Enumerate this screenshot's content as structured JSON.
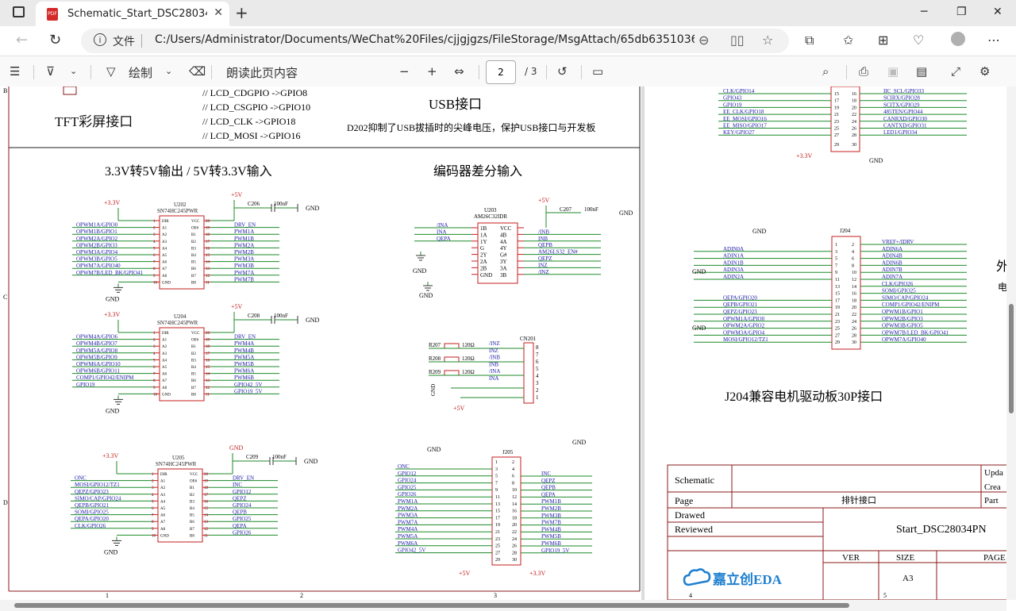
{
  "browser": {
    "tab_title": "Schematic_Start_DSC28034PNT_V",
    "pdf_badge": "PDF",
    "file_label": "文件",
    "url": "C:/Users/Administrator/Documents/WeChat%20Files/cjjgjgzs/FileStorage/MsgAttach/65db63510361e9532e..."
  },
  "pdf_toolbar": {
    "draw_label": "绘制",
    "read_aloud_label": "朗读此页内容",
    "page_current": "2",
    "page_total": "/ 3"
  },
  "schematic": {
    "top_left": {
      "tft_title": "TFT彩屏接口",
      "pin_notes": [
        "// LCD_CDGPIO ->GPIO8",
        "// LCD_CSGPIO ->GPIO10",
        "// LCD_CLK ->GPIO18",
        "// LCD_MOSI ->GPIO16"
      ],
      "usb_title": "USB接口",
      "usb_note": "D202抑制了USB拔插时的尖峰电压，保护USB接口与开发板"
    },
    "level_shift_title": "3.3V转5V输出 / 5V转3.3V输入",
    "encoder_title": "编码器差分输入",
    "u202": {
      "ref": "U202",
      "part": "SN74HC245PWR",
      "vcc": "+3.3V",
      "pwr": "+5V",
      "cap": "C206",
      "capval": "100nF",
      "gnd": "GND",
      "left_nets": [
        "OPWM1A/GPIO0",
        "OPWM1B/GPIO1",
        "OPWM2A/GPIO2",
        "OPWM2B/GPIO3",
        "OPWM3A/GPIO4",
        "OPWM3B/GPIO5",
        "OPWM7A/GPIO40",
        "OPWM7B/LED_BK/GPIO41"
      ],
      "right_nets": [
        "DRV_EN",
        "PWM1A",
        "PWM1B",
        "PWM2A",
        "PWM2B",
        "PWM3A",
        "PWM3B",
        "PWM7A",
        "PWM7B"
      ]
    },
    "u204": {
      "ref": "U204",
      "part": "SN74HC245PWR",
      "vcc": "+3.3V",
      "pwr": "+5V",
      "cap": "C208",
      "capval": "100nF",
      "gnd": "GND",
      "left_nets": [
        "OPWM4A/GPIO6",
        "OPWM4B/GPIO7",
        "OPWM5A/GPIO8",
        "OPWM5B/GPIO9",
        "OPWM6A/GPIO10",
        "OPWM6B/GPIO11",
        "COMP1/GPIO42/ENIPM",
        "GPIO19"
      ],
      "right_nets": [
        "DRV_EN",
        "PWM4A",
        "PWM4B",
        "PWM5A",
        "PWM5B",
        "PWM6A",
        "PWM6B",
        "GPIO42_5V",
        "GPIO19_5V"
      ]
    },
    "u205": {
      "ref": "U205",
      "part": "SN74HC245PWR",
      "vcc": "+3.3V",
      "pwr": "GND",
      "cap": "C209",
      "capval": "100nF",
      "gnd": "GND",
      "left_nets": [
        "ONC",
        "MOSI/GPIO12/TZ1",
        "QEPZ/GPIO23",
        "SIMO/CAP/GPIO24",
        "QEPB/GPIO21",
        "SOMI/GPIO25",
        "QEPA/GPIO20",
        "CLK/GPIO26"
      ],
      "right_nets": [
        "DRV_EN",
        "INC",
        "GPIO12",
        "QEPZ",
        "GPIO24",
        "QEPB",
        "GPIO25",
        "QEPA",
        "GPIO26"
      ]
    },
    "chip_pins_left": [
      "DIR",
      "A1",
      "A2",
      "A3",
      "A4",
      "A5",
      "A6",
      "A7",
      "A8",
      "GND"
    ],
    "chip_pins_right": [
      "VCC",
      "OE#",
      "B1",
      "B2",
      "B3",
      "B4",
      "B5",
      "B6",
      "B7",
      "B8"
    ],
    "u203": {
      "ref": "U203",
      "part": "AM26C32IDR",
      "pwr": "+5V",
      "cap": "C207",
      "capval": "100nF",
      "gnd": "GND",
      "left_nets": [
        "/INA",
        "INA",
        "QEPA"
      ],
      "left_pins": [
        "1B",
        "1A",
        "1Y",
        "G",
        "2Y",
        "2A",
        "2B",
        "GND"
      ],
      "right_pins": [
        "VCC",
        "4B",
        "4A",
        "4Y",
        "G#",
        "3Y",
        "3A",
        "3B"
      ],
      "right_nets": [
        "/INB",
        "INB",
        "QEPB",
        "AM26LS32_EN#",
        "QEPZ",
        "INZ",
        "/INZ"
      ]
    },
    "cn201": {
      "ref": "CN201",
      "resistors": [
        "R207",
        "R208",
        "R209"
      ],
      "rval": "120Ω",
      "nets": [
        "/INZ",
        "INZ",
        "/INB",
        "INB",
        "/INA",
        "INA"
      ],
      "gnd": "GND",
      "pwr": "+5V"
    },
    "j205": {
      "ref": "J205",
      "gnd": "GND",
      "pwr1": "+5V",
      "pwr2": "+3.3V",
      "left_nets": [
        "ONC",
        "GPIO12",
        "GPIO24",
        "GPIO25",
        "GPIO26",
        "PWM1A",
        "PWM2A",
        "PWM3A",
        "PWM7A",
        "PWM4A",
        "PWM5A",
        "PWM6A",
        "GPIO42_5V"
      ],
      "right_nets": [
        "INC",
        "QEPZ",
        "QEPB",
        "QEPA",
        "PWM1B",
        "PWM2B",
        "PWM3B",
        "PWM7B",
        "PWM4B",
        "PWM5B",
        "PWM6B",
        "GPIO19_5V"
      ]
    },
    "j_top": {
      "left_nets": [
        "CLK/GPIO14",
        "GPIO43",
        "GPIO19",
        "EE_CLK/GPIO18",
        "EE_MOSI/GPIO16",
        "EE_MISO/GPIO17",
        "KEY/GPIO27"
      ],
      "right_nets": [
        "IIC_SCL/GPIO33",
        "SCIRX/GPIO28",
        "SCITX/GPIO29",
        "485TEN/GPIO44",
        "CANRXD/GPIO30",
        "CANTXD/GPIO31",
        "LED1/GPIO34"
      ],
      "pwr": "+3.3V",
      "gnd": "GND"
    },
    "j204": {
      "ref": "J204",
      "gnd": "GND",
      "left_nets": [
        "ADIN0A",
        "ADIN1A",
        "ADIN1B",
        "ADIN3A",
        "ADIN2A",
        "QEPA/GPIO20",
        "QEPB/GPIO21",
        "QEPZ/GPIO23",
        "OPWM1A/GPIO0",
        "OPWM2A/GPIO2",
        "OPWM3A/GPIO4",
        "MOSI/GPIO12/TZ1"
      ],
      "right_nets": [
        "VREF+/IDRV",
        "ADIN6A",
        "ADIN4B",
        "ADIN6B",
        "ADIN7B",
        "ADIN7A",
        "CLK/GPIO26",
        "SOMI/GPIO25",
        "SIMO/CAP/GPIO24",
        "COMP1/GPIO42/ENIPM",
        "OPWM1B/GPIO1",
        "OPWM2B/GPIO3",
        "OPWM3B/GPIO5",
        "OPWM7B/LED_BK/GPIO41",
        "OPWM7A/GPIO40"
      ],
      "title": "J204兼容电机驱动板30P接口"
    },
    "edge_chars": [
      "外",
      "电"
    ],
    "title_block": {
      "schematic": "Schematic",
      "page": "Page",
      "page_value": "排针接口",
      "drawed": "Drawed",
      "reviewed": "Reviewed",
      "name": "Start_DSC28034PN",
      "ver": "VER",
      "size": "SIZE",
      "size_value": "A3",
      "page_col": "PAGE",
      "upd": "Upda",
      "crea": "Crea",
      "part": "Part",
      "logo": "嘉立创EDA"
    },
    "border_numbers": [
      "1",
      "2",
      "3",
      "4",
      "5"
    ],
    "border_letters": [
      "B",
      "C",
      "D"
    ]
  }
}
